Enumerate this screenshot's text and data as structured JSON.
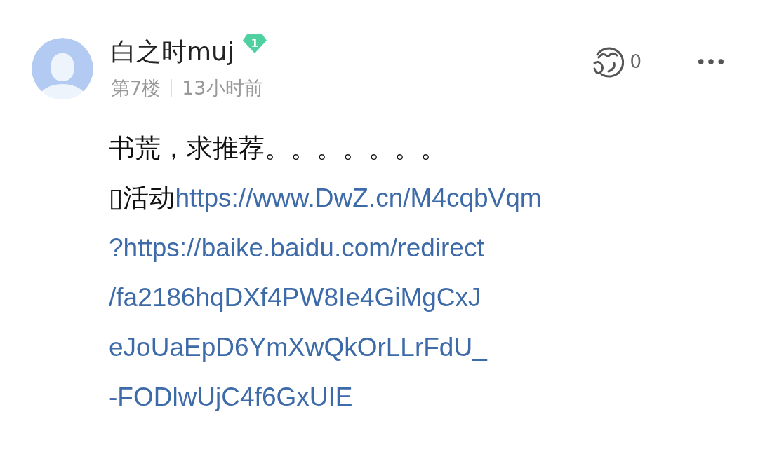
{
  "comment": {
    "username": "白之时muj",
    "level_badge": "1",
    "floor": "第7楼",
    "time": "13小时前",
    "reaction_count": "0",
    "text_line": "书荒，求推荐。。。。。。。",
    "prefix": "▯活动",
    "link_lines": [
      "https://www.DwZ.cn/M4cqbVqm",
      "?https://baike.baidu.com/redirect",
      "/fa2186hqDXf4PW8Ie4GiMgCxJ",
      "eJoUaEpD6YmXwQkOrLLrFdU_",
      "-FODlwUjC4f6GxUIE"
    ]
  }
}
